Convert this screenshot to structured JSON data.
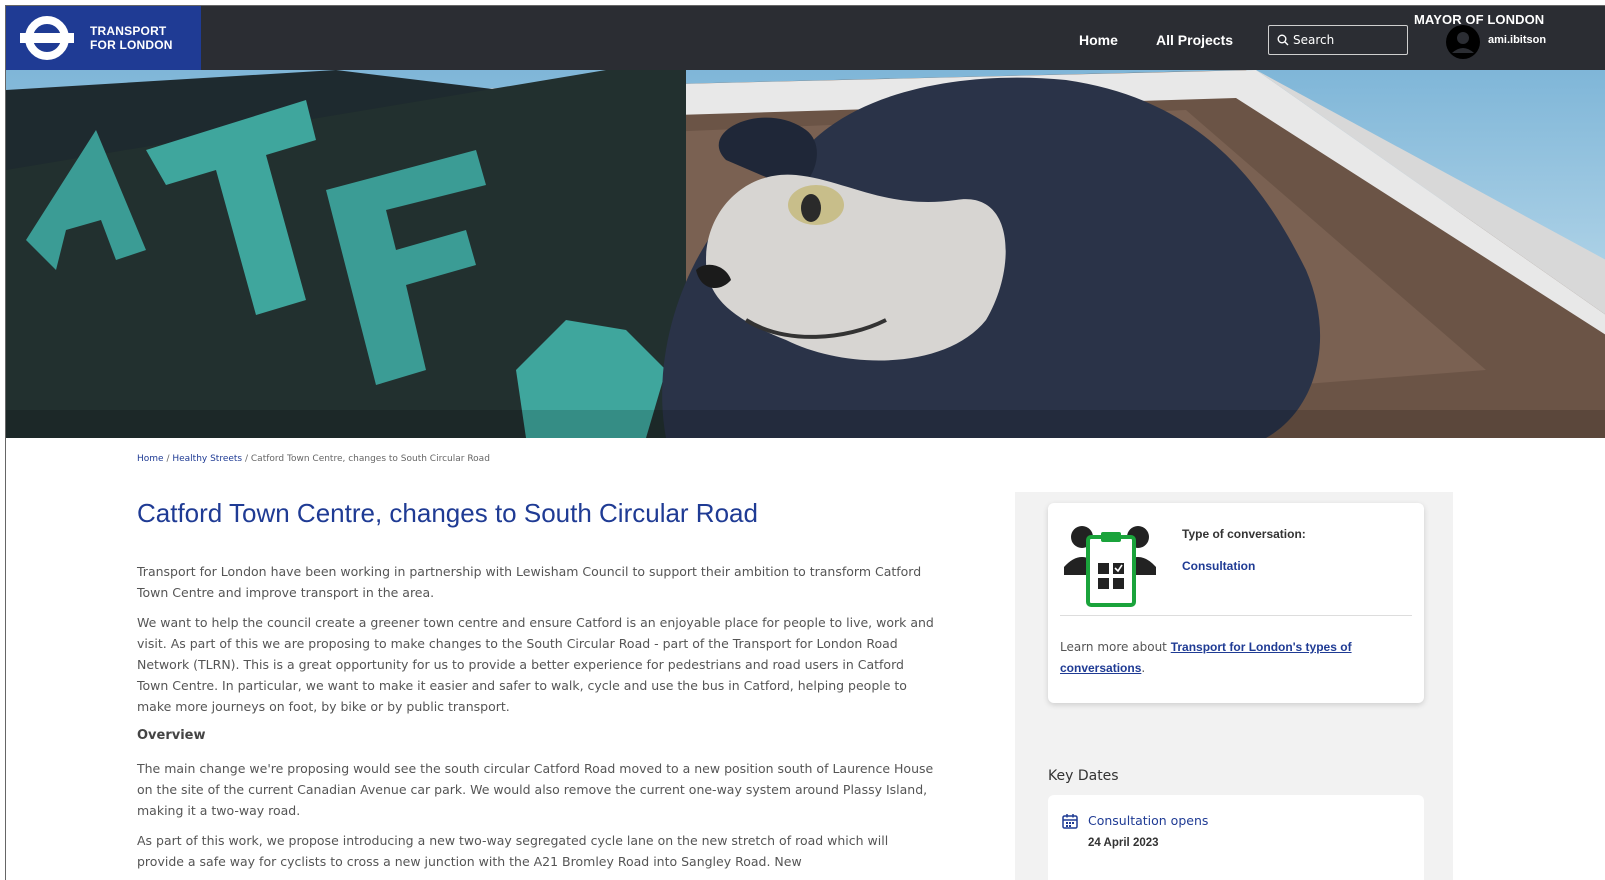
{
  "header": {
    "logo_line1": "TRANSPORT",
    "logo_line2": "FOR LONDON",
    "nav": [
      "Home",
      "All Projects"
    ],
    "search_placeholder": "Search",
    "mayor": "MAYOR OF LONDON",
    "username": "ami.ibitson"
  },
  "breadcrumb": {
    "home": "Home",
    "section": "Healthy Streets",
    "current": "Catford Town Centre, changes to South Circular Road",
    "sep": " / "
  },
  "page": {
    "title": "Catford Town Centre, changes to South Circular Road",
    "para1": "Transport for London have been working in partnership with Lewisham Council to support their ambition to transform Catford Town Centre and improve transport in the area.",
    "para2": "We want to help the council create a greener town centre and ensure Catford is an enjoyable place for people to live, work and visit. As part of this we are proposing to make changes to the South Circular Road - part of the Transport for London Road Network (TLRN). This is a great opportunity for us to provide a better experience for pedestrians and road users in Catford Town Centre. In particular, we want to make it easier and safer to walk, cycle and use the bus in Catford, helping people to make more journeys on foot, by bike or by public transport.",
    "overview_heading": "Overview",
    "para3": "The main change we're proposing would see the south circular Catford Road moved to a new position south of Laurence House on the site of the current Canadian Avenue car park. We would also remove the current one-way system around Plassy Island, making it a two-way road.",
    "para4": "As part of this work, we propose introducing a new two-way segregated cycle lane on the new stretch of road which will provide a safe way for cyclists to cross a new junction with the A21 Bromley Road into Sangley Road. New"
  },
  "sidebar": {
    "type_label": "Type of conversation:",
    "type_value": "Consultation",
    "learn_prefix": "Learn more about ",
    "learn_link": "Transport for London's types of conversations",
    "learn_suffix": ".",
    "key_dates_heading": "Key Dates",
    "dates": [
      {
        "label": "Consultation opens",
        "value": "24 April 2023"
      }
    ]
  },
  "colors": {
    "brand_blue": "#1f3b94",
    "header_bg": "#2b2d33",
    "icon_green": "#1aa33b"
  }
}
